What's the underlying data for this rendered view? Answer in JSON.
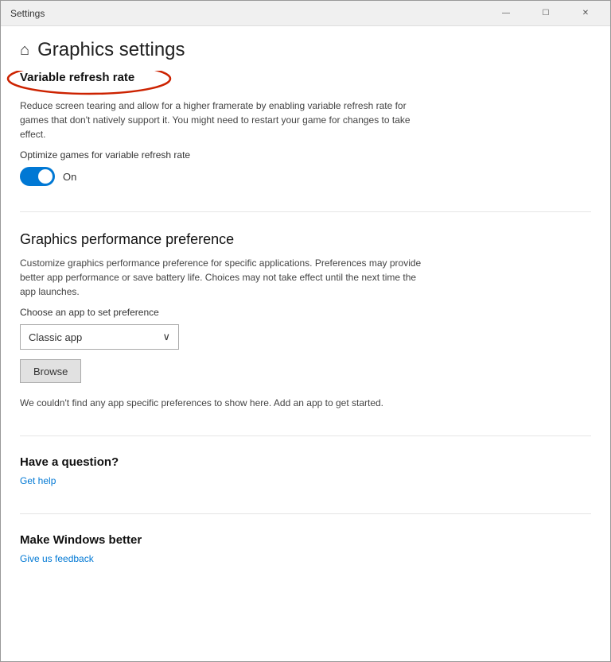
{
  "window": {
    "title": "Settings"
  },
  "titlebar": {
    "title": "Settings",
    "minimize_label": "—",
    "maximize_label": "☐",
    "close_label": "✕"
  },
  "nav": {
    "back_icon": "←"
  },
  "header": {
    "home_icon": "⌂",
    "title": "Graphics settings"
  },
  "vrr_section": {
    "title": "Variable refresh rate",
    "description": "Reduce screen tearing and allow for a higher framerate by enabling variable refresh rate for games that don't natively support it. You might need to restart your game for changes to take effect.",
    "optimize_label": "Optimize games for variable refresh rate",
    "toggle_state": "On"
  },
  "graphics_section": {
    "title": "Graphics performance preference",
    "description": "Customize graphics performance preference for specific applications. Preferences may provide better app performance or save battery life. Choices may not take effect until the next time the app launches.",
    "choose_label": "Choose an app to set preference",
    "dropdown_value": "Classic app",
    "browse_label": "Browse",
    "empty_state": "We couldn't find any app specific preferences to show here. Add an app to get started."
  },
  "help_section": {
    "title": "Have a question?",
    "link": "Get help"
  },
  "feedback_section": {
    "title": "Make Windows better",
    "link": "Give us feedback"
  }
}
